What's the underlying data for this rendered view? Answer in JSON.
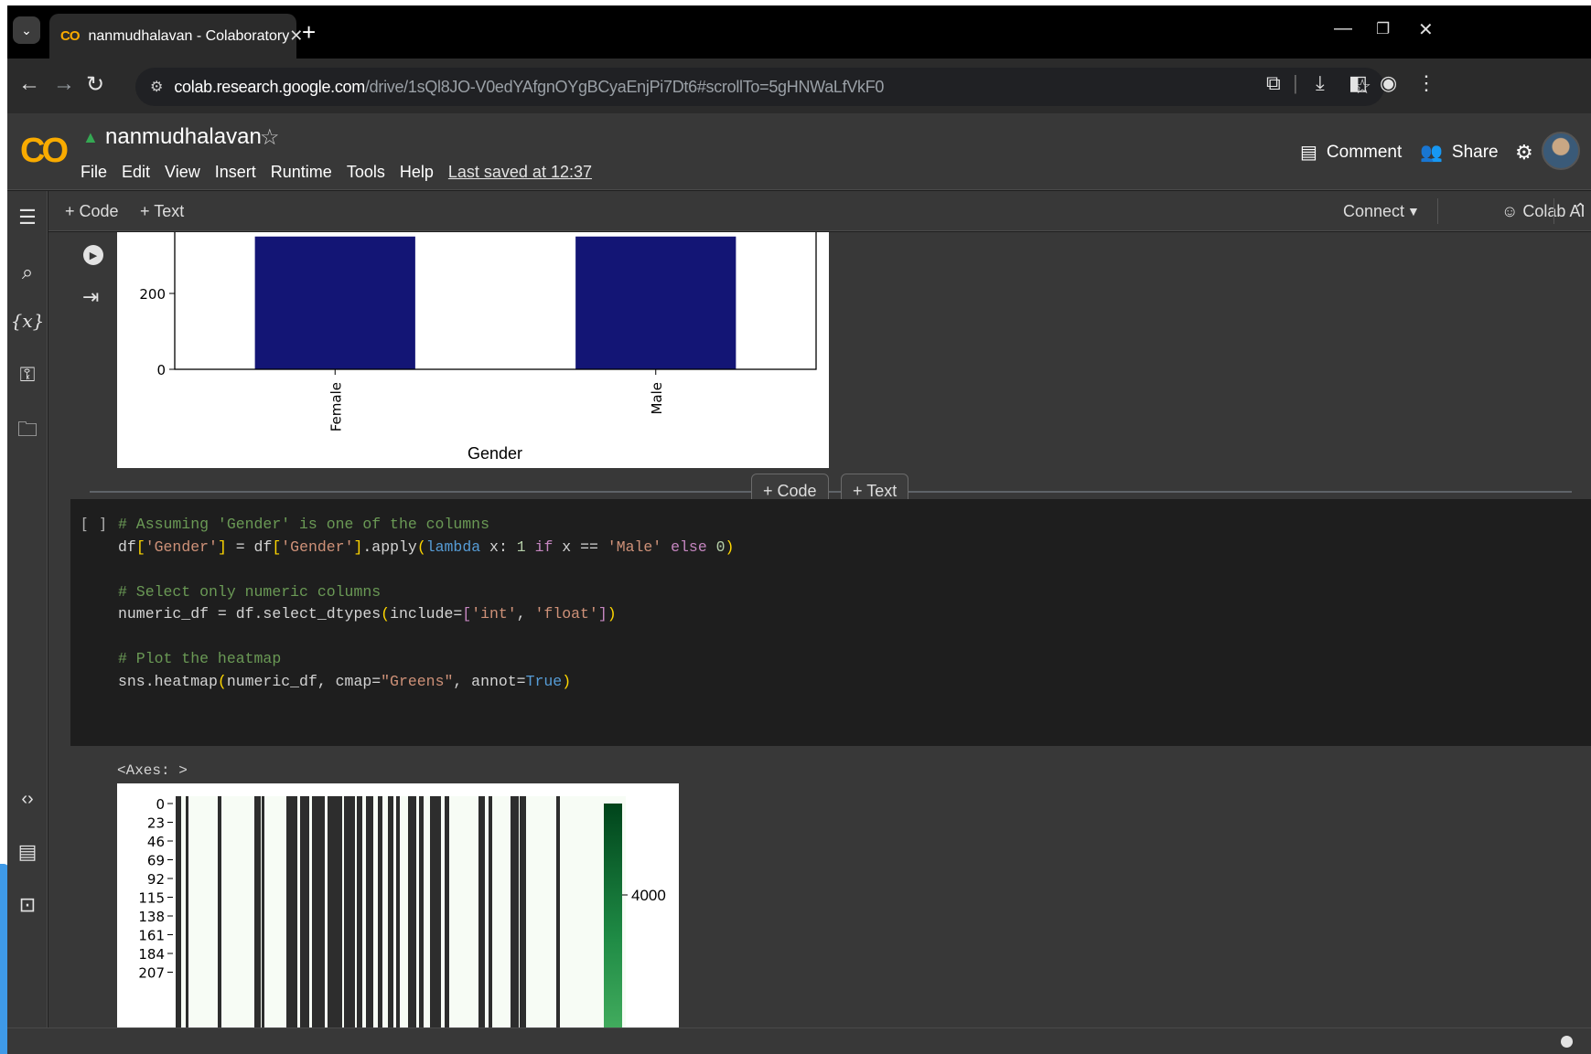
{
  "browser": {
    "tab_title": "nanmudhalavan - Colaboratory",
    "tab_logo": "CO",
    "url_host": "colab.research.google.com",
    "url_path": "/drive/1sQl8JO-V0edYAfgnOYgBCyaEnjPi7Dt6#scrollTo=5gHNWaLfVkF0"
  },
  "colab": {
    "logo": "CO",
    "notebook_title": "nanmudhalavan",
    "menu": [
      "File",
      "Edit",
      "View",
      "Insert",
      "Runtime",
      "Tools",
      "Help"
    ],
    "last_saved": "Last saved at 12:37",
    "comment_label": "Comment",
    "share_label": "Share"
  },
  "toolbar": {
    "add_code": "+ Code",
    "add_text": "+ Text",
    "connect": "Connect",
    "colab_ai": "Colab AI"
  },
  "between_cells": {
    "add_code": "+ Code",
    "add_text": "+ Text"
  },
  "code_cell": {
    "exec_count": "[ ]",
    "comment1": "# Assuming 'Gender' is one of the columns",
    "comment2": "# Select only numeric columns",
    "comment3": "# Plot the heatmap"
  },
  "output": {
    "axes_text": "<Axes: >"
  },
  "icons": {
    "rail": [
      "toc-icon",
      "search-icon",
      "variables-icon",
      "key-icon",
      "folder-icon",
      "code-snippets-icon",
      "command-palette-icon",
      "terminal-icon"
    ],
    "accent_color": "#f9ab00"
  },
  "chart_data": [
    {
      "type": "bar",
      "categories": [
        "Female",
        "Male"
      ],
      "values": [
        350,
        350
      ],
      "xlabel": "Gender",
      "yticks": [
        0,
        200
      ],
      "ylim": [
        0,
        330
      ],
      "bar_color": "#131575"
    },
    {
      "type": "heatmap",
      "yticks": [
        "0",
        "23",
        "46",
        "69",
        "92",
        "115",
        "138",
        "161",
        "184",
        "207"
      ],
      "colorbar_tick": "4000",
      "cmap": "Greens"
    }
  ]
}
